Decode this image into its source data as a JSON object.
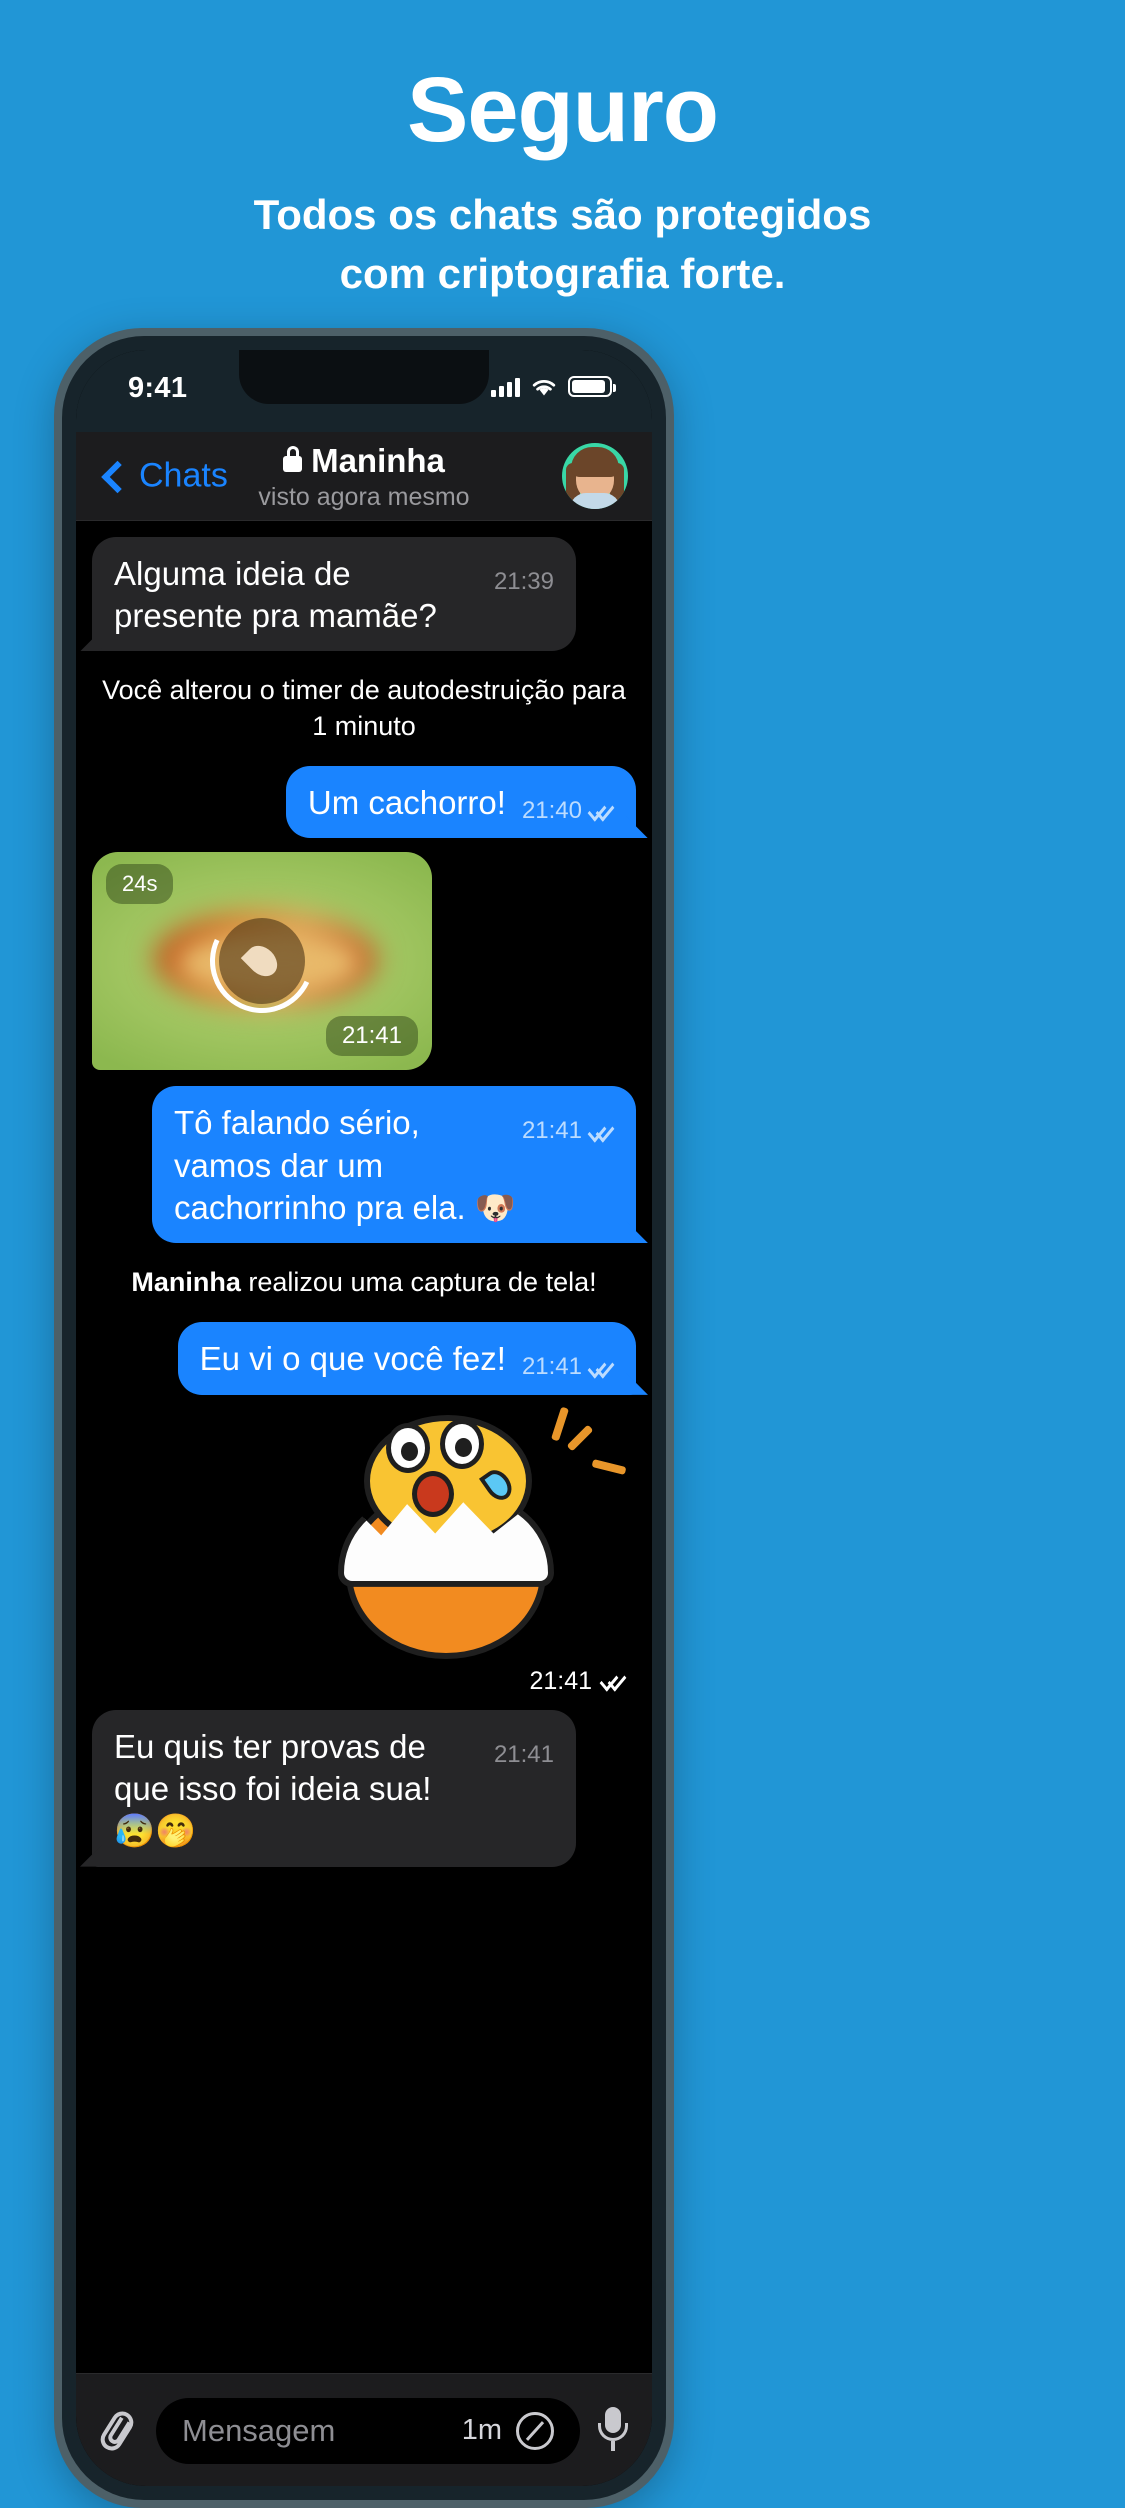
{
  "promo": {
    "title": "Seguro",
    "subtitle_line1": "Todos os chats são protegidos",
    "subtitle_line2": "com criptografia forte.",
    "background_color": "#2196d6"
  },
  "status_bar": {
    "time": "9:41",
    "signal_icon": "cellular-signal-icon",
    "wifi_icon": "wifi-icon",
    "battery_icon": "battery-icon"
  },
  "chat_header": {
    "back_label": "Chats",
    "back_icon": "chevron-left-icon",
    "lock_icon": "lock-icon",
    "title": "Maninha",
    "status": "visto agora mesmo",
    "avatar_label": "avatar"
  },
  "messages": [
    {
      "kind": "bubble",
      "direction": "in",
      "text": "Alguma ideia de presente pra mamãe?",
      "time": "21:39",
      "ticks": false
    },
    {
      "kind": "service",
      "text": "Você alterou o timer de autodestruição para 1 minuto"
    },
    {
      "kind": "bubble",
      "direction": "out",
      "text": "Um cachorro!",
      "time": "21:40",
      "ticks": true
    },
    {
      "kind": "photo",
      "direction": "in",
      "duration_badge": "24s",
      "time": "21:41",
      "burn_icon": "self-destruct-flame-icon"
    },
    {
      "kind": "bubble",
      "direction": "out",
      "text": "Tô falando sério, vamos dar um cachorrinho pra ela. 🐶",
      "time": "21:41",
      "ticks": true
    },
    {
      "kind": "service",
      "bold_prefix": "Maninha",
      "text": " realizou uma captura de tela!"
    },
    {
      "kind": "bubble",
      "direction": "out",
      "text": "Eu vi o que você fez!",
      "time": "21:41",
      "ticks": true
    },
    {
      "kind": "sticker",
      "direction": "out",
      "sticker_name": "shocked-egg-sticker",
      "time": "21:41",
      "ticks": true
    },
    {
      "kind": "bubble",
      "direction": "in",
      "text": "Eu quis ter provas de que isso foi ideia sua! 😰🤭",
      "time": "21:41",
      "ticks": false
    }
  ],
  "input_bar": {
    "attach_icon": "paperclip-icon",
    "placeholder": "Mensagem",
    "timer_value": "1m",
    "timer_icon": "self-destruct-timer-icon",
    "mic_icon": "microphone-icon"
  },
  "colors": {
    "brand_blue": "#2196d6",
    "bubble_out": "#1a84ff",
    "bubble_in": "#262628",
    "accent_link": "#1a84ff"
  }
}
